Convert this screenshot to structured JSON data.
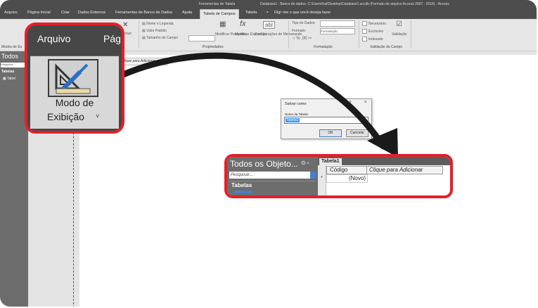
{
  "title_bar": {
    "table_tools": "Ferramentas de Tabela",
    "doc_title": "Database1 : Banco de dados- C:\\Users\\hal\\Desktop\\Database1.accdb (Formato de arquivo Access 2007 - 2016) - Access"
  },
  "ribbon_tabs": [
    "Arquivo",
    "Página Inicial",
    "Criar",
    "Dados Externos",
    "Ferramentas de Banco de Dados",
    "Ajuda",
    "Tabela de Campos",
    "Tabela"
  ],
  "tell_me": "Digi~me o que você deseja fazer",
  "ribbon": {
    "view_button": "Modo de Exibição",
    "delete": "Excluir",
    "name_caption": "Nome e Legenda",
    "default_value": "Valor Padrão",
    "field_size": "Tamanho do Campo",
    "modify_lookups": "Modificar Pesquisas",
    "modify_expression": "Modificar Expressão",
    "memo_settings": "Configurações de Memorando",
    "data_type": "Tipo de Dados:",
    "format": "Formato:",
    "format_value": "Formatação",
    "required": "Necessário",
    "unique": "Exclusivo",
    "indexed": "Indexado",
    "validation": "Validação",
    "group_views": "Modos de Ex",
    "group_properties": "Propriedades",
    "group_formatting": "Formatação",
    "group_validation": "Validação do Campo"
  },
  "nav_pane": {
    "title": "Todos",
    "search": "Pesquisar...",
    "group": "Tabelas",
    "item": "Tabel"
  },
  "sheet": {
    "header": "Clique para Adicionar"
  },
  "dialog": {
    "title": "Salvar como",
    "help": "?",
    "close": "×",
    "label": "Nome da Tabela:",
    "value": "Tabela1",
    "ok": "OK",
    "cancel": "Cancelar"
  },
  "zoom_view": {
    "file_tab": "Arquivo",
    "next_tab": "Pág",
    "label_line1": "Modo de",
    "label_line2": "Exibição",
    "chevron": "˅"
  },
  "zoom_table": {
    "nav_title": "Todos os Objeto...",
    "nav_controls": "⊙ ‹",
    "search": "Pesquisar...",
    "group": "Tabelas",
    "tab": "Tabela1",
    "col1": "Código",
    "col2": "Clique para Adicionar",
    "new_record": "(Novo)",
    "row_marker": "*"
  },
  "colors": {
    "highlight": "#e2202a",
    "dark_ui": "#4d4d4d",
    "nav_gray": "#6d6d6d"
  }
}
